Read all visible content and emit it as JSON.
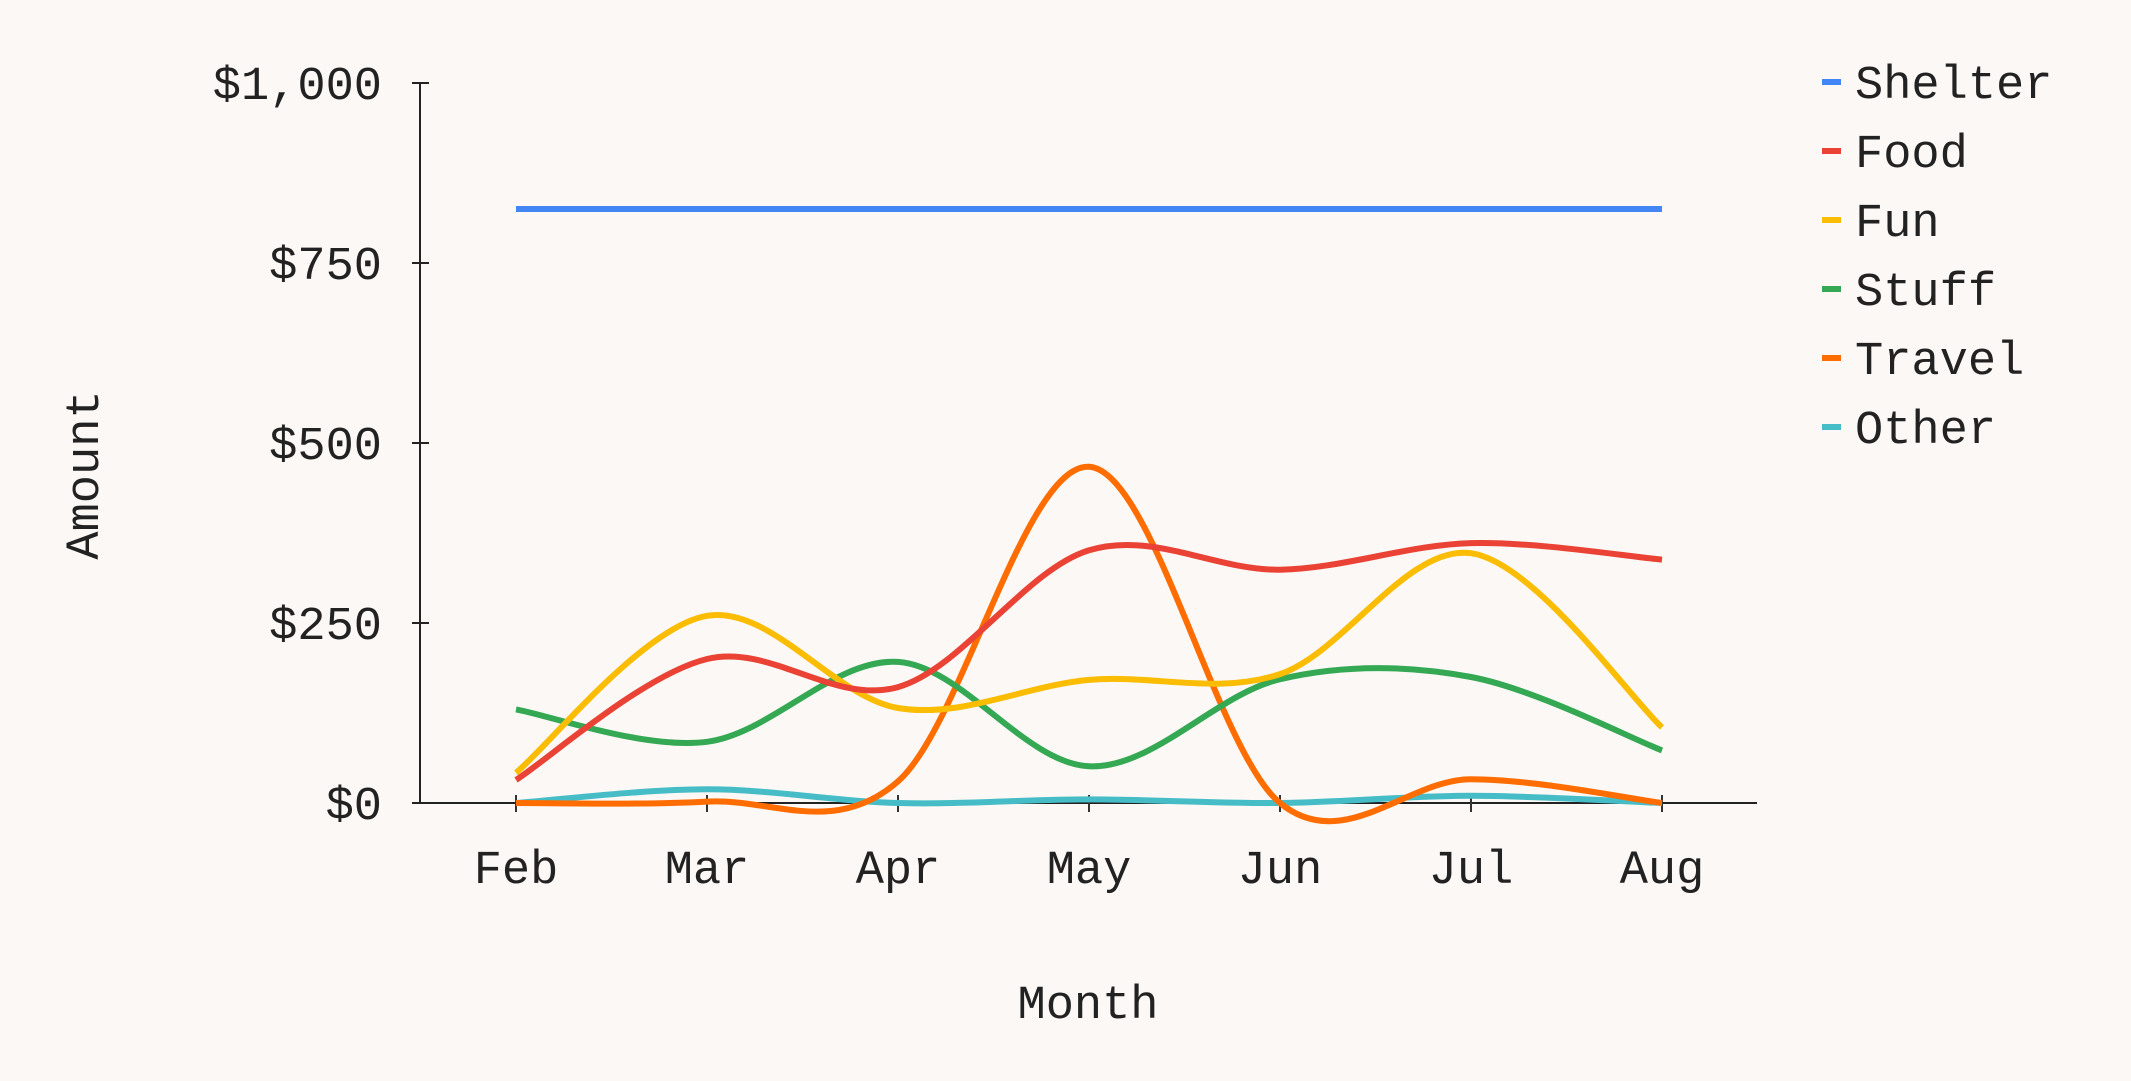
{
  "chart_data": {
    "type": "line",
    "title": "",
    "xlabel": "Month",
    "ylabel": "Amount",
    "categories": [
      "Feb",
      "Mar",
      "Apr",
      "May",
      "Jun",
      "Jul",
      "Aug"
    ],
    "ylim": [
      0,
      1000
    ],
    "yticks": [
      0,
      250,
      500,
      750,
      1000
    ],
    "ytick_labels": [
      "$0",
      "$250",
      "$500",
      "$750",
      "$1,000"
    ],
    "grid": false,
    "smooth": true,
    "legend_position": "right-top",
    "series": [
      {
        "name": "Shelter",
        "color": "#4285f4",
        "values": [
          825,
          825,
          825,
          825,
          825,
          825,
          825
        ]
      },
      {
        "name": "Food",
        "color": "#ea4335",
        "values": [
          32,
          200,
          161,
          351,
          324,
          361,
          338
        ]
      },
      {
        "name": "Fun",
        "color": "#fbbc04",
        "values": [
          42,
          260,
          132,
          171,
          179,
          347,
          105
        ]
      },
      {
        "name": "Stuff",
        "color": "#34a853",
        "values": [
          130,
          85,
          196,
          51,
          172,
          175,
          73
        ]
      },
      {
        "name": "Travel",
        "color": "#ff6d01",
        "values": [
          0,
          2,
          30,
          467,
          0,
          33,
          0
        ]
      },
      {
        "name": "Other",
        "color": "#46bdc6",
        "values": [
          0,
          19,
          0,
          5,
          0,
          10,
          0
        ]
      }
    ]
  }
}
